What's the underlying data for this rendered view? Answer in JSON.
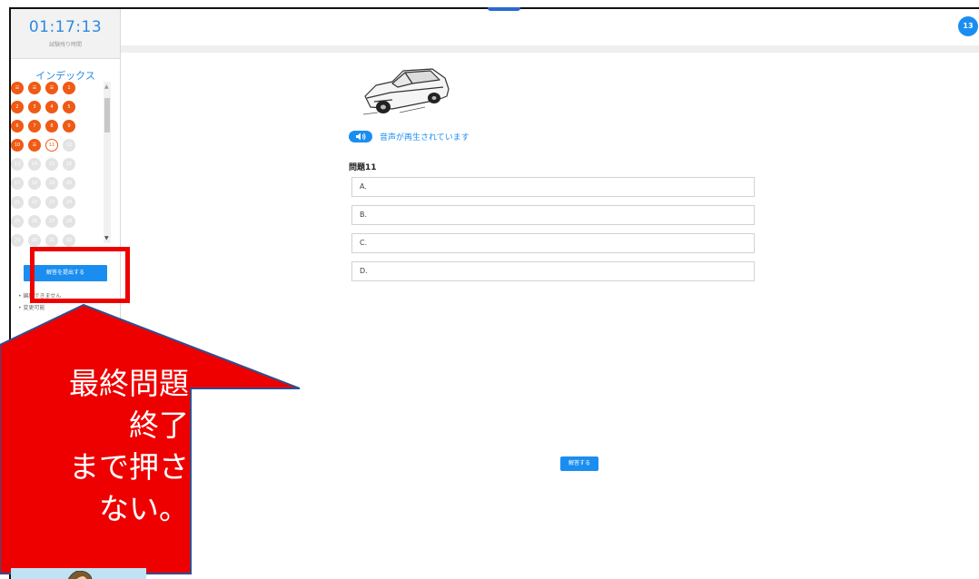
{
  "timer": {
    "time": "01:17:13",
    "label": "試験残り時間"
  },
  "sidebar": {
    "index_title": "インデックス",
    "grid": [
      [
        {
          "label": "☰",
          "state": "done"
        },
        {
          "label": "☰",
          "state": "done"
        },
        {
          "label": "☰",
          "state": "done"
        },
        {
          "label": "1",
          "state": "done"
        }
      ],
      [
        {
          "label": "2",
          "state": "done"
        },
        {
          "label": "3",
          "state": "done"
        },
        {
          "label": "4",
          "state": "done"
        },
        {
          "label": "5",
          "state": "done"
        }
      ],
      [
        {
          "label": "6",
          "state": "done"
        },
        {
          "label": "7",
          "state": "done"
        },
        {
          "label": "8",
          "state": "done"
        },
        {
          "label": "9",
          "state": "done"
        }
      ],
      [
        {
          "label": "10",
          "state": "done"
        },
        {
          "label": "☰",
          "state": "done"
        },
        {
          "label": "11",
          "state": "current"
        },
        {
          "label": "12",
          "state": "pending"
        }
      ],
      [
        {
          "label": "13",
          "state": "pending"
        },
        {
          "label": "14",
          "state": "pending"
        },
        {
          "label": "15",
          "state": "pending"
        },
        {
          "label": "16",
          "state": "pending"
        }
      ],
      [
        {
          "label": "17",
          "state": "pending"
        },
        {
          "label": "18",
          "state": "pending"
        },
        {
          "label": "19",
          "state": "pending"
        },
        {
          "label": "20",
          "state": "pending"
        }
      ],
      [
        {
          "label": "21",
          "state": "pending"
        },
        {
          "label": "22",
          "state": "pending"
        },
        {
          "label": "23",
          "state": "pending"
        },
        {
          "label": "24",
          "state": "pending"
        }
      ],
      [
        {
          "label": "25",
          "state": "pending"
        },
        {
          "label": "26",
          "state": "pending"
        },
        {
          "label": "27",
          "state": "pending"
        },
        {
          "label": "28",
          "state": "pending"
        }
      ],
      [
        {
          "label": "29",
          "state": "pending"
        },
        {
          "label": "30",
          "state": "pending"
        },
        {
          "label": "31",
          "state": "pending"
        },
        {
          "label": "32",
          "state": "pending"
        }
      ]
    ],
    "submit_label": "解答を提出する",
    "notes": [
      "編集できません",
      "変更可能"
    ]
  },
  "header": {
    "badge": "13"
  },
  "question": {
    "audio_status": "音声が再生されています",
    "title": "問題11",
    "options": [
      "A.",
      "B.",
      "C.",
      "D."
    ]
  },
  "answer_button": "解答する",
  "callout": {
    "text": "最終問題\n終了\nまで押さ\nない。"
  },
  "colors": {
    "accent": "#1a8ef0",
    "done": "#f05a14",
    "pending": "#e3e3e3",
    "callout": "#ee0000"
  },
  "icons": {
    "audio": "speaker-icon",
    "image": "car-image"
  }
}
